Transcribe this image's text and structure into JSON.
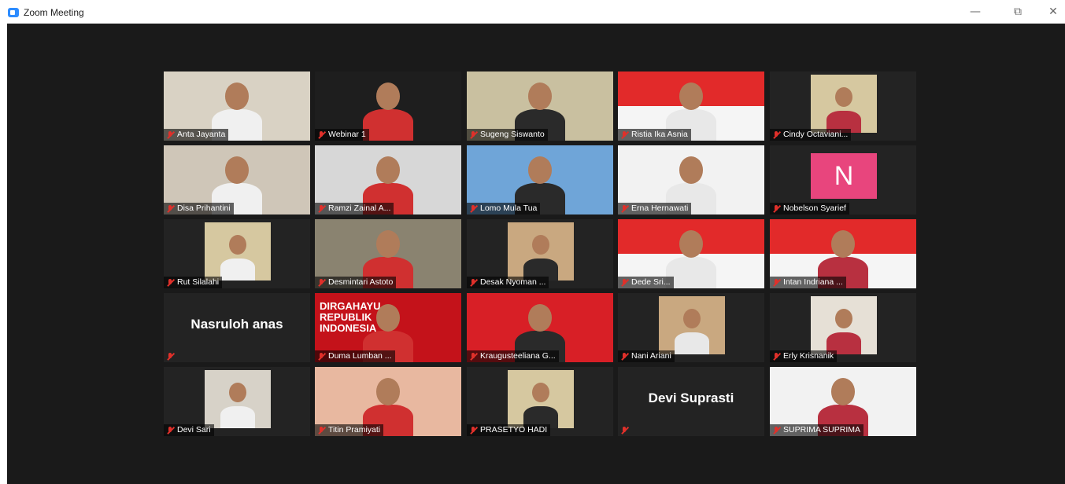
{
  "window": {
    "title": "Zoom Meeting",
    "minimize": "—",
    "restore": "⧉",
    "close": "✕"
  },
  "participants": [
    {
      "name": "Anta Jayanta",
      "bg": "#d9d2c4"
    },
    {
      "name": "Webinar 1",
      "bg": "#1e1e1e"
    },
    {
      "name": "Sugeng Siswanto",
      "bg": "#c9c0a0"
    },
    {
      "name": "Ristia Ika Asnia",
      "bg": "#e22a2a"
    },
    {
      "name": "Cindy Octaviani...",
      "bg": "#232323"
    },
    {
      "name": "Disa Prihantini",
      "bg": "#cfc6b8"
    },
    {
      "name": "Ramzi Zainal A...",
      "bg": "#d7d7d7"
    },
    {
      "name": "Lomo Mula Tua",
      "bg": "#6fa5d8"
    },
    {
      "name": "Erna Hernawati",
      "bg": "#f2f2f2"
    },
    {
      "name": "Nobelson Syarief",
      "bg": "#232323",
      "avatar": "N"
    },
    {
      "name": "Rut Silalahi",
      "bg": "#232323"
    },
    {
      "name": "Desmintari Astoto",
      "bg": "#8a8370"
    },
    {
      "name": "Desak Nyoman ...",
      "bg": "#232323"
    },
    {
      "name": "Dede Sri...",
      "bg": "#e22a2a"
    },
    {
      "name": "Intan Indriana ...",
      "bg": "#e22a2a"
    },
    {
      "name": "",
      "bg": "#232323",
      "display": "Nasruloh anas"
    },
    {
      "name": "Duma Lumban ...",
      "bg": "#c4121a",
      "banner": "DIRGAHAYU REPUBLIK INDONESIA"
    },
    {
      "name": "Kraugusteeliana G...",
      "bg": "#d81f26",
      "active": true
    },
    {
      "name": "Nani Ariani",
      "bg": "#232323"
    },
    {
      "name": "Erly Krisnanik",
      "bg": "#232323"
    },
    {
      "name": "Devi Sari",
      "bg": "#232323"
    },
    {
      "name": "Titin Pramiyati",
      "bg": "#e8b8a0"
    },
    {
      "name": "PRASETYO HADI",
      "bg": "#232323"
    },
    {
      "name": "",
      "bg": "#232323",
      "display": "Devi Suprasti"
    },
    {
      "name": "SUPRIMA SUPRIMA",
      "bg": "#f2f2f2"
    }
  ]
}
